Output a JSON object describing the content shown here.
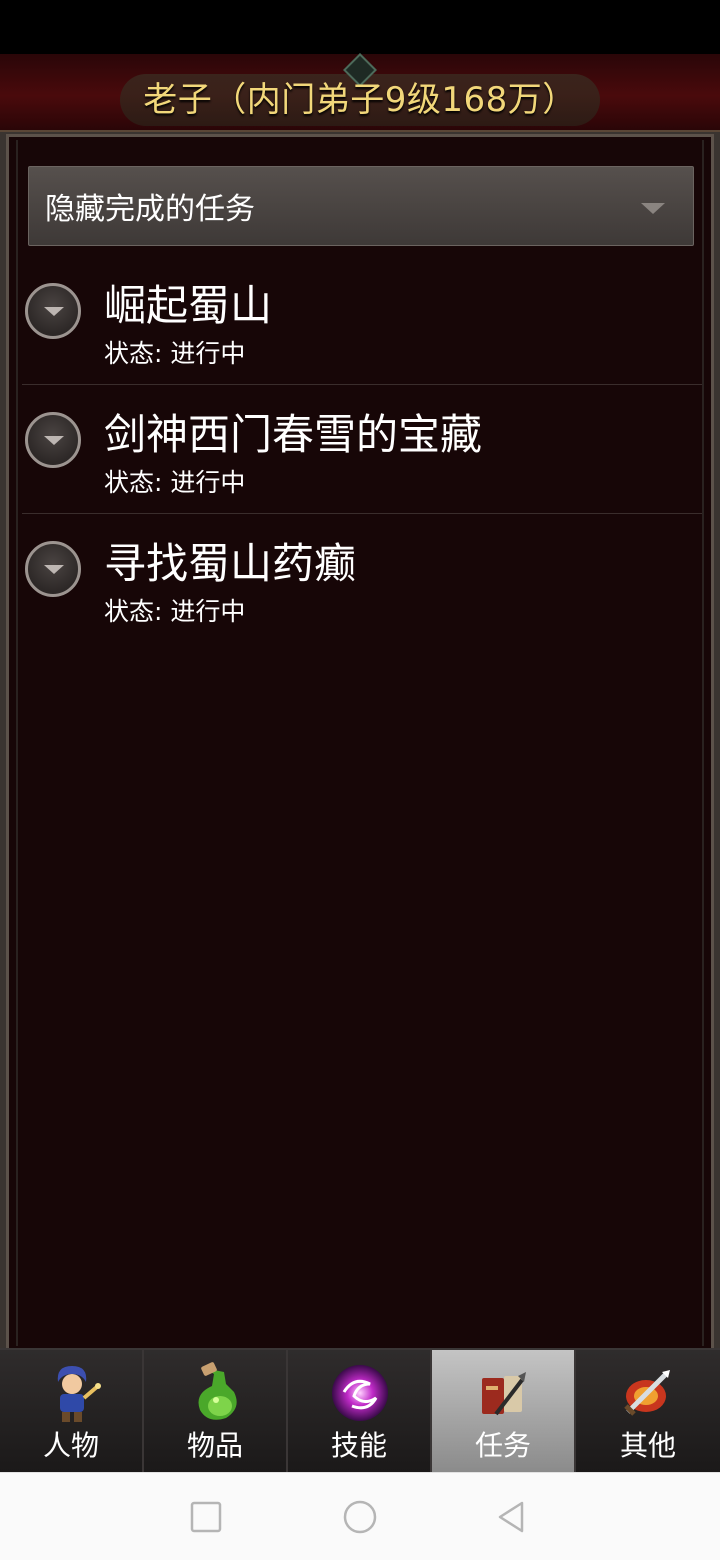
{
  "header": {
    "title": "老子（内门弟子9级168万）"
  },
  "filter": {
    "selected": "隐藏完成的任务"
  },
  "quests": [
    {
      "name": "崛起蜀山",
      "status": "状态: 进行中"
    },
    {
      "name": "剑神西门春雪的宝藏",
      "status": "状态: 进行中"
    },
    {
      "name": "寻找蜀山药癫",
      "status": "状态: 进行中"
    }
  ],
  "tabs": [
    {
      "label": "人物",
      "icon": "character-icon",
      "active": false
    },
    {
      "label": "物品",
      "icon": "potion-icon",
      "active": false
    },
    {
      "label": "技能",
      "icon": "skill-orb-icon",
      "active": false
    },
    {
      "label": "任务",
      "icon": "quest-icon",
      "active": true
    },
    {
      "label": "其他",
      "icon": "sword-icon",
      "active": false
    }
  ],
  "navbar": {
    "buttons": [
      "recents-icon",
      "home-icon",
      "back-icon"
    ]
  }
}
